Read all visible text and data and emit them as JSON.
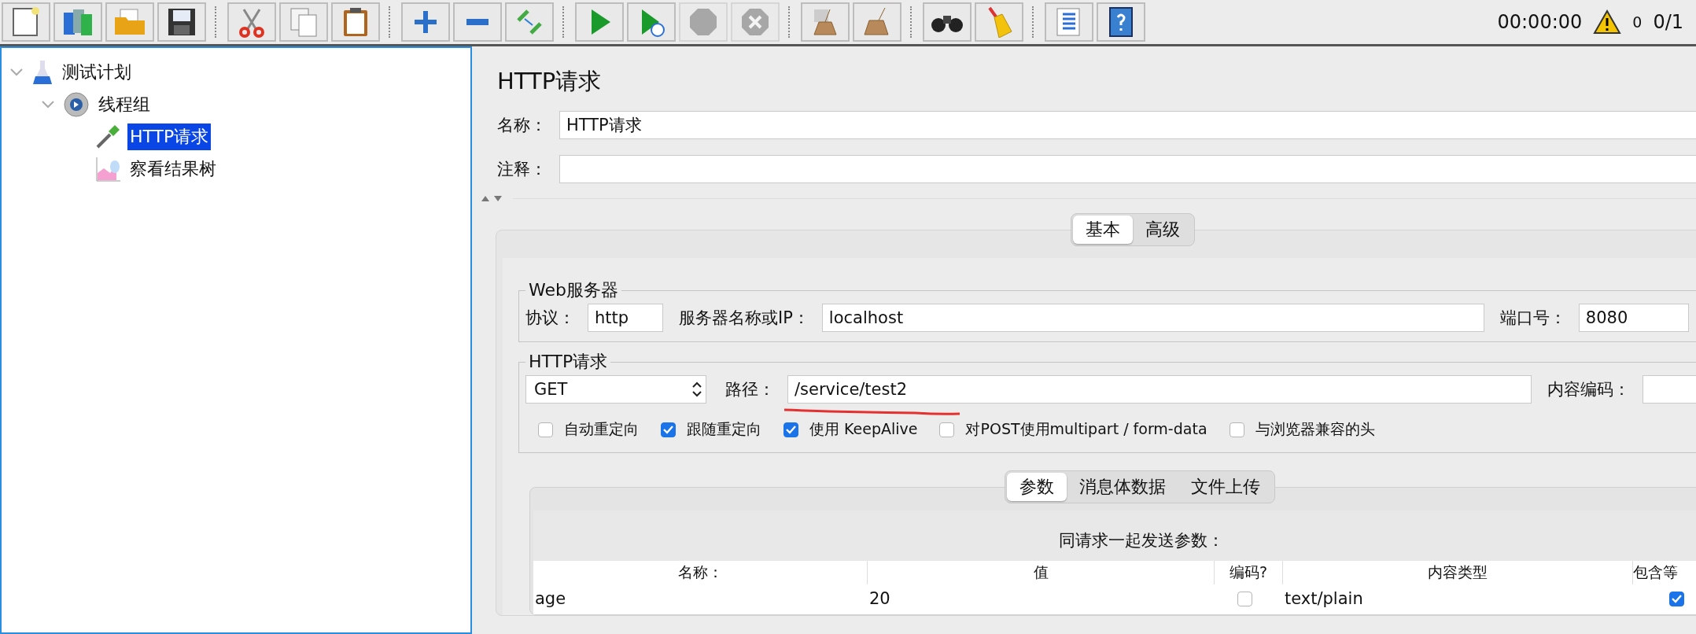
{
  "toolbar": {
    "groups": [
      {
        "buttons": [
          {
            "disabled": false
          },
          {
            "disabled": false
          },
          {
            "disabled": false
          },
          {
            "disabled": false
          }
        ]
      },
      {
        "buttons": [
          {
            "disabled": false
          },
          {
            "disabled": false
          },
          {
            "disabled": false
          }
        ]
      },
      {
        "buttons": [
          {
            "disabled": false
          },
          {
            "disabled": false
          },
          {
            "disabled": false
          }
        ]
      },
      {
        "buttons": [
          {
            "disabled": false
          },
          {
            "disabled": false
          },
          {
            "disabled": true
          },
          {
            "disabled": true
          }
        ]
      },
      {
        "buttons": [
          {
            "disabled": false
          },
          {
            "disabled": false
          }
        ]
      },
      {
        "buttons": [
          {
            "disabled": false
          },
          {
            "disabled": false
          }
        ]
      },
      {
        "buttons": [
          {
            "disabled": false
          },
          {
            "disabled": false
          }
        ]
      }
    ],
    "timer": "00:00:00",
    "warnings": "0",
    "threads": "0/1"
  },
  "tree": [
    {
      "label": "测试计划",
      "kind": "plan",
      "expanded": true,
      "selected": false,
      "children": [
        {
          "label": "线程组",
          "kind": "thread-group",
          "expanded": true,
          "selected": false,
          "children": [
            {
              "label": "HTTP请求",
              "kind": "sampler",
              "selected": true
            },
            {
              "label": "察看结果树",
              "kind": "listener",
              "selected": false
            }
          ]
        }
      ]
    }
  ],
  "editor": {
    "title": "HTTP请求",
    "name": {
      "label": "名称：",
      "value": "HTTP请求"
    },
    "comment": {
      "label": "注释："
    },
    "tabs": [
      {
        "label": "基本",
        "selected": true
      },
      {
        "label": "高级",
        "selected": false
      }
    ],
    "web_server": {
      "legend": "Web服务器",
      "fields": [
        {
          "label": "协议：",
          "value": "http"
        },
        {
          "label": "服务器名称或IP：",
          "value": "localhost"
        },
        {
          "label": "端口号：",
          "value": "8080"
        }
      ]
    },
    "http_request": {
      "legend": "HTTP请求",
      "method": "GET",
      "path_label": "路径：",
      "path": "/service/test2",
      "encoding_label": "内容编码：",
      "options": [
        {
          "label": "自动重定向",
          "checked": false
        },
        {
          "label": "跟随重定向",
          "checked": true
        },
        {
          "label": "使用 KeepAlive",
          "checked": true
        },
        {
          "label": "对POST使用multipart / form-data",
          "checked": false
        },
        {
          "label": "与浏览器兼容的头",
          "checked": false
        }
      ]
    },
    "body_tabs": [
      {
        "label": "参数",
        "selected": true
      },
      {
        "label": "消息体数据",
        "selected": false
      },
      {
        "label": "文件上传",
        "selected": false
      }
    ],
    "parameters": {
      "caption": "同请求一起发送参数：",
      "columns": [
        "名称：",
        "值",
        "编码?",
        "内容类型",
        "包含等"
      ],
      "rows": [
        {
          "name": "age",
          "value": "20",
          "encode": false,
          "content_type": "text/plain",
          "include_equals": true
        }
      ]
    }
  }
}
